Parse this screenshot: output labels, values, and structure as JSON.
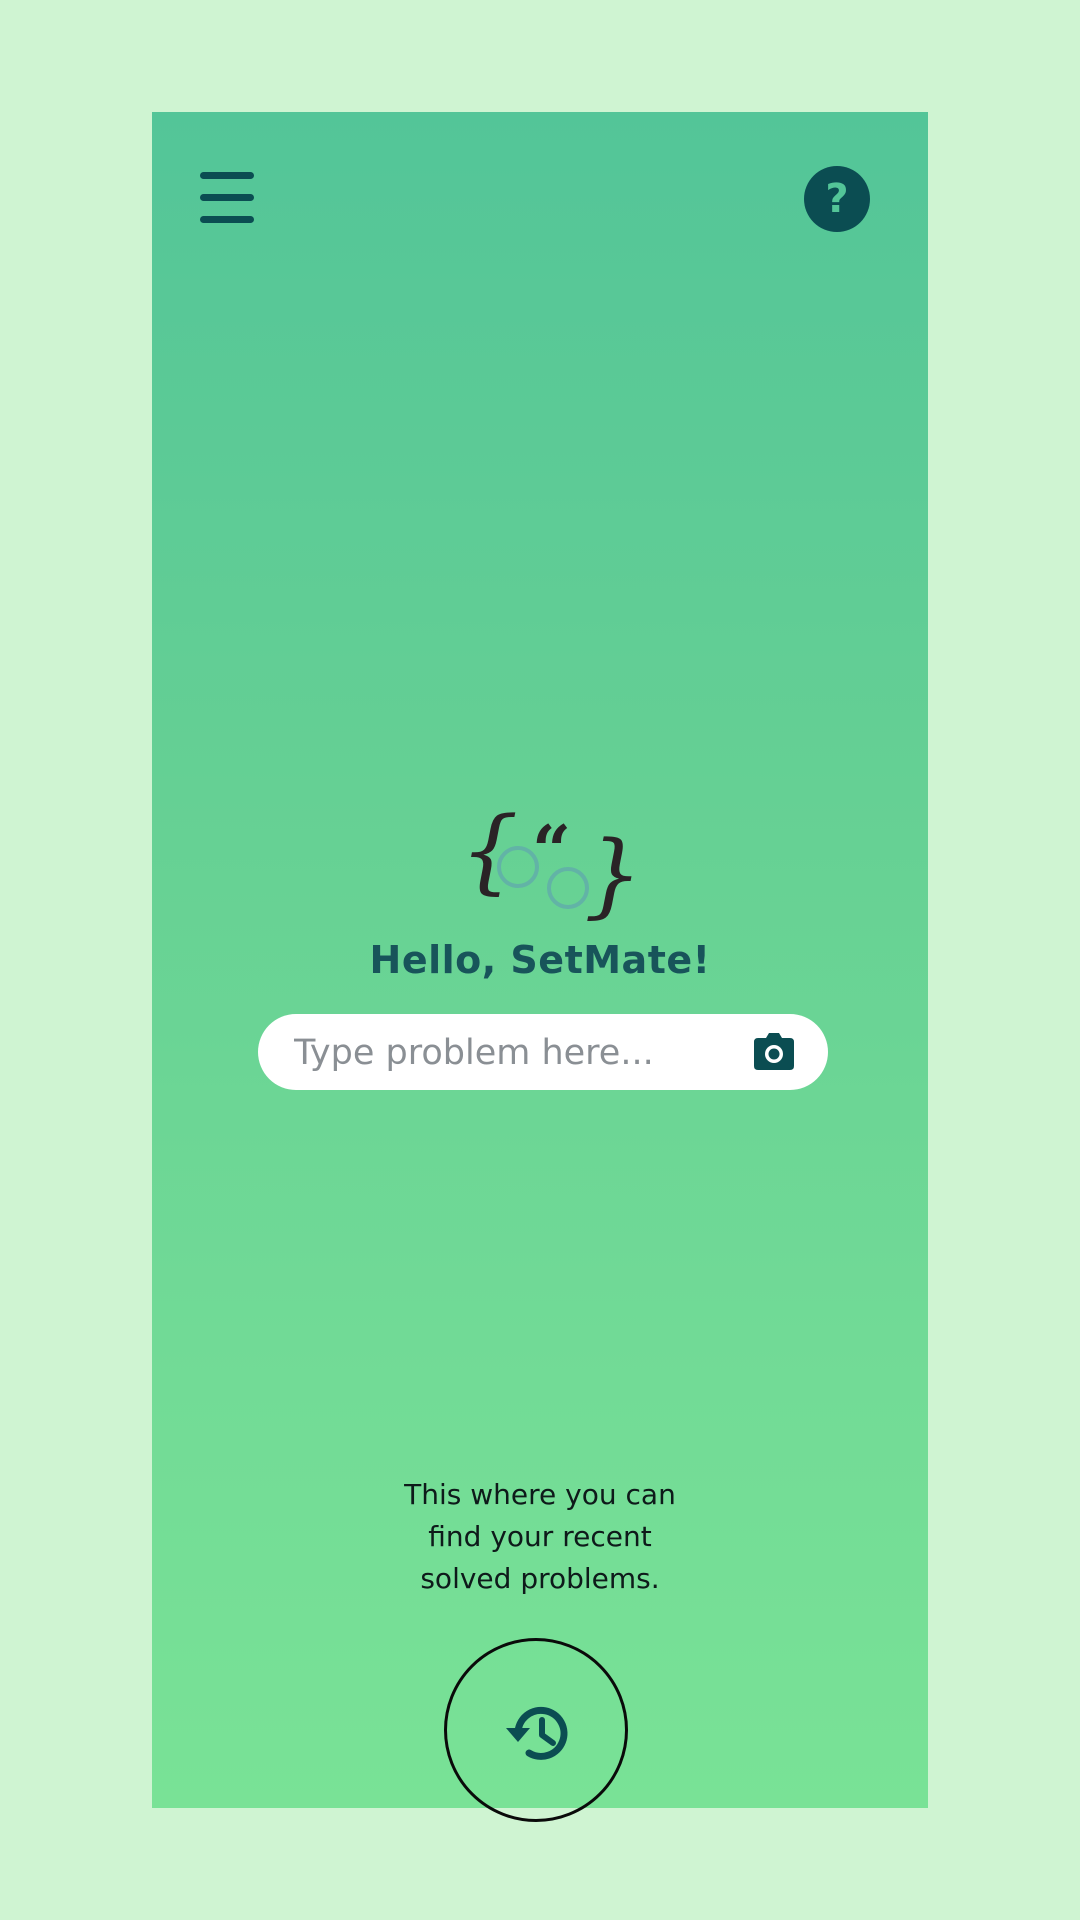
{
  "app": {
    "greeting": "Hello, SetMate!"
  },
  "header": {
    "menu_icon": "hamburger-menu-icon",
    "help_icon": "help-question-icon",
    "help_glyph": "?"
  },
  "logo": {
    "left_brace": "{",
    "quote": "“",
    "right_brace": "}"
  },
  "search": {
    "placeholder": "Type problem here...",
    "value": "",
    "camera_icon": "camera-icon"
  },
  "history": {
    "hint_line1": "This where you can",
    "hint_line2": "find your recent",
    "hint_line3": "solved problems.",
    "icon": "history-clock-icon"
  },
  "colors": {
    "page_background": "#cff4d2",
    "gradient_top": "#53c598",
    "gradient_bottom": "#79e296",
    "accent_dark": "#0b4d52"
  }
}
